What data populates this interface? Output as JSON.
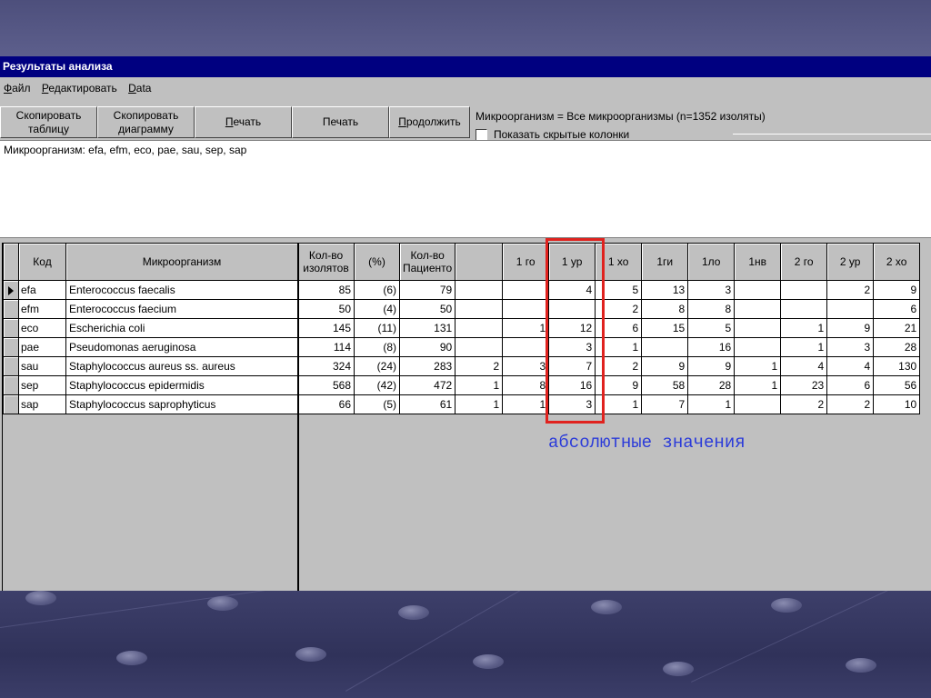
{
  "window": {
    "title": "Результаты анализа"
  },
  "menu": [
    {
      "mnemonic": "Ф",
      "rest": "айл"
    },
    {
      "mnemonic": "Р",
      "rest": "едактировать"
    },
    {
      "mnemonic": "D",
      "rest": "ata"
    }
  ],
  "toolbar": {
    "copy_table_line1": "Скопировать",
    "copy_table_line2": "таблицу",
    "copy_chart_line1": "Скопировать",
    "copy_chart_line2": "диаграмму",
    "print1_mnemonic": "П",
    "print1_rest": "ечать",
    "print2": "Печать",
    "continue_mnemonic": "П",
    "continue_rest": "родолжить"
  },
  "info": {
    "microorganism": "Микроорганизм = Все микроорганизмы   (n=1352 изоляты)",
    "show_hidden": "Показать скрытые колонки"
  },
  "filter_text": "Микроорганизм:   efa, efm, eco, pae, sau, sep, sap",
  "table": {
    "headers": [
      "Код",
      "Микроорганизм",
      "Кол-во изолятов",
      "(%)",
      "Кол-во Пациенто",
      "",
      "1 го",
      "1 ур",
      "1 хо",
      "1ги",
      "1ло",
      "1нв",
      "2 го",
      "2 ур",
      "2 хо"
    ],
    "rows": [
      [
        "efa",
        "Enterococcus faecalis",
        "85",
        "(6)",
        "79",
        "",
        "",
        "4",
        "5",
        "13",
        "3",
        "",
        "",
        "2",
        "9"
      ],
      [
        "efm",
        "Enterococcus faecium",
        "50",
        "(4)",
        "50",
        "",
        "",
        "",
        "2",
        "8",
        "8",
        "",
        "",
        "",
        "6"
      ],
      [
        "eco",
        "Escherichia coli",
        "145",
        "(11)",
        "131",
        "",
        "1",
        "12",
        "6",
        "15",
        "5",
        "",
        "1",
        "9",
        "21"
      ],
      [
        "pae",
        "Pseudomonas aeruginosa",
        "114",
        "(8)",
        "90",
        "",
        "",
        "3",
        "1",
        "",
        "16",
        "",
        "1",
        "3",
        "28"
      ],
      [
        "sau",
        "Staphylococcus aureus ss. aureus",
        "324",
        "(24)",
        "283",
        "2",
        "3",
        "7",
        "2",
        "9",
        "9",
        "1",
        "4",
        "4",
        "130"
      ],
      [
        "sep",
        "Staphylococcus epidermidis",
        "568",
        "(42)",
        "472",
        "1",
        "8",
        "16",
        "9",
        "58",
        "28",
        "1",
        "23",
        "6",
        "56"
      ],
      [
        "sap",
        "Staphylococcus saprophyticus",
        "66",
        "(5)",
        "61",
        "1",
        "1",
        "3",
        "1",
        "7",
        "1",
        "",
        "2",
        "2",
        "10"
      ]
    ]
  },
  "annotation": "абсолютные значения",
  "colors": {
    "titlebar": "#000080",
    "highlight": "#e0221e",
    "annotation": "#2b3bd9"
  }
}
